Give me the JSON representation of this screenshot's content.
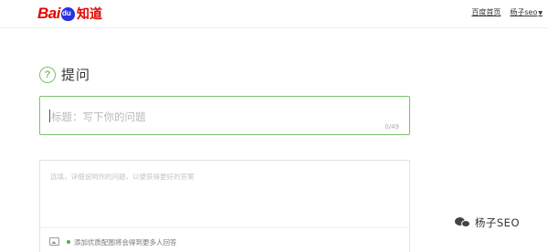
{
  "header": {
    "logo_text": "Bai du 知道",
    "links": [
      "百度首页",
      "杨子seo"
    ]
  },
  "page": {
    "title": "提问",
    "question_icon_glyph": "?"
  },
  "title_input": {
    "placeholder": "标题：写下你的问题",
    "counter": "0/49"
  },
  "description": {
    "placeholder": "选填，详细说明你的问题，以便获得更好的答案",
    "image_hint": "添加优质配图将会得到更多人回答"
  },
  "watermark": {
    "text": "杨子SEO"
  },
  "colors": {
    "brand_red": "#e10601",
    "brand_blue": "#2932e1",
    "accent_green": "#78c46a"
  }
}
